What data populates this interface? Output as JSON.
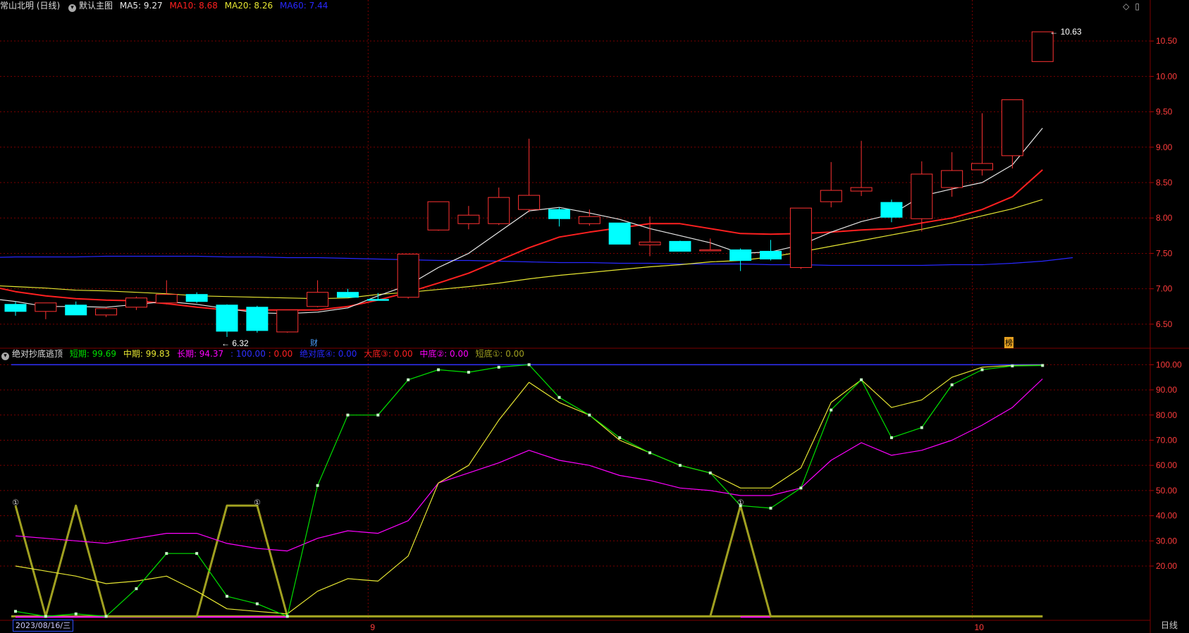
{
  "main_header": {
    "title": "常山北明 (日线)",
    "template": "默认主图",
    "ma5_label": "MA5: 9.27",
    "ma10_label": "MA10: 8.68",
    "ma20_label": "MA20: 8.26",
    "ma60_label": "MA60: 7.44"
  },
  "indicator_header": {
    "title": "绝对抄底逃顶",
    "short_label": "短期: 99.69",
    "mid_label": "中期: 99.83",
    "long_label": "长期: 94.37",
    "level_label": ": 100.00",
    "zero_label": ": 0.00",
    "abs_bottom_label": "绝对底④: 0.00",
    "big_bottom_label": "大底③: 0.00",
    "mid_bottom_label": "中底②: 0.00",
    "short_bottom_label": "短底①: 0.00"
  },
  "markers": {
    "cai": "财",
    "bang": "榜"
  },
  "footer": {
    "date": "2023/08/16/三",
    "period": "日线"
  },
  "colors": {
    "up": "#ff3232",
    "down": "#00ffff",
    "ma5": "#e8e8e8",
    "ma10": "#ff2020",
    "ma20": "#e6e632",
    "ma60": "#2828ff",
    "grid": "#7a0000",
    "short": "#00e000",
    "mid": "#e6e632",
    "long": "#ff00ff",
    "signal": "#a0a020",
    "level": "#3030ff"
  },
  "chart_data": [
    {
      "type": "candlestick",
      "title": "常山北明 (日线)",
      "y_ticks": [
        "6.50",
        "7.00",
        "7.50",
        "8.00",
        "8.50",
        "9.00",
        "9.50",
        "10.00",
        "10.50"
      ],
      "ylim": [
        6.2,
        10.9
      ],
      "x_ticks": [
        {
          "index": 12,
          "label": "9"
        },
        {
          "index": 32,
          "label": "10"
        }
      ],
      "candles": [
        {
          "o": 6.78,
          "h": 6.82,
          "l": 6.62,
          "c": 6.68
        },
        {
          "o": 6.68,
          "h": 6.8,
          "l": 6.57,
          "c": 6.8
        },
        {
          "o": 6.77,
          "h": 6.82,
          "l": 6.63,
          "c": 6.63
        },
        {
          "o": 6.63,
          "h": 6.74,
          "l": 6.6,
          "c": 6.72
        },
        {
          "o": 6.74,
          "h": 6.89,
          "l": 6.7,
          "c": 6.87
        },
        {
          "o": 6.8,
          "h": 7.12,
          "l": 6.78,
          "c": 6.92
        },
        {
          "o": 6.92,
          "h": 6.95,
          "l": 6.8,
          "c": 6.82
        },
        {
          "o": 6.77,
          "h": 6.78,
          "l": 6.32,
          "c": 6.4
        },
        {
          "o": 6.74,
          "h": 6.76,
          "l": 6.38,
          "c": 6.41
        },
        {
          "o": 6.39,
          "h": 6.7,
          "l": 6.38,
          "c": 6.7
        },
        {
          "o": 6.75,
          "h": 7.12,
          "l": 6.74,
          "c": 6.95
        },
        {
          "o": 6.95,
          "h": 7.0,
          "l": 6.88,
          "c": 6.88
        },
        {
          "o": 6.85,
          "h": 6.94,
          "l": 6.84,
          "c": 6.84
        },
        {
          "o": 6.88,
          "h": 7.49,
          "l": 6.86,
          "c": 7.49
        },
        {
          "o": 7.83,
          "h": 8.23,
          "l": 7.82,
          "c": 8.23
        },
        {
          "o": 7.92,
          "h": 8.17,
          "l": 7.84,
          "c": 8.04
        },
        {
          "o": 7.92,
          "h": 8.43,
          "l": 7.9,
          "c": 8.29
        },
        {
          "o": 8.12,
          "h": 9.12,
          "l": 8.08,
          "c": 8.32
        },
        {
          "o": 8.12,
          "h": 8.15,
          "l": 7.88,
          "c": 7.99
        },
        {
          "o": 7.92,
          "h": 8.12,
          "l": 7.89,
          "c": 8.02
        },
        {
          "o": 7.93,
          "h": 7.93,
          "l": 7.63,
          "c": 7.63
        },
        {
          "o": 7.62,
          "h": 8.02,
          "l": 7.46,
          "c": 7.66
        },
        {
          "o": 7.67,
          "h": 7.68,
          "l": 7.53,
          "c": 7.53
        },
        {
          "o": 7.54,
          "h": 7.71,
          "l": 7.53,
          "c": 7.55
        },
        {
          "o": 7.55,
          "h": 7.57,
          "l": 7.25,
          "c": 7.4
        },
        {
          "o": 7.53,
          "h": 7.69,
          "l": 7.4,
          "c": 7.42
        },
        {
          "o": 7.3,
          "h": 8.14,
          "l": 7.28,
          "c": 8.14
        },
        {
          "o": 8.23,
          "h": 8.79,
          "l": 8.15,
          "c": 8.39
        },
        {
          "o": 8.38,
          "h": 9.09,
          "l": 8.31,
          "c": 8.43
        },
        {
          "o": 8.22,
          "h": 8.26,
          "l": 7.94,
          "c": 8.01
        },
        {
          "o": 7.99,
          "h": 8.8,
          "l": 7.81,
          "c": 8.62
        },
        {
          "o": 8.43,
          "h": 8.93,
          "l": 8.3,
          "c": 8.67
        },
        {
          "o": 8.68,
          "h": 9.48,
          "l": 8.6,
          "c": 8.77
        },
        {
          "o": 8.88,
          "h": 9.67,
          "l": 8.7,
          "c": 9.67
        },
        {
          "o": 10.21,
          "h": 10.63,
          "l": 10.21,
          "c": 10.63
        }
      ],
      "ma5": [
        6.87,
        6.82,
        6.75,
        6.75,
        6.74,
        6.78,
        6.82,
        6.78,
        6.72,
        6.66,
        6.65,
        6.67,
        6.73,
        6.9,
        7.05,
        7.3,
        7.5,
        7.8,
        8.1,
        8.15,
        8.07,
        7.98,
        7.85,
        7.75,
        7.65,
        7.5,
        7.52,
        7.62,
        7.8,
        7.95,
        8.05,
        8.31,
        8.41,
        8.5,
        8.75,
        9.27
      ],
      "ma10": [
        7.05,
        6.96,
        6.9,
        6.86,
        6.84,
        6.83,
        6.79,
        6.74,
        6.7,
        6.7,
        6.7,
        6.7,
        6.75,
        6.84,
        6.95,
        7.08,
        7.22,
        7.4,
        7.58,
        7.73,
        7.8,
        7.86,
        7.92,
        7.92,
        7.85,
        7.78,
        7.77,
        7.78,
        7.8,
        7.83,
        7.85,
        7.93,
        8.0,
        8.12,
        8.3,
        8.68
      ],
      "ma20": [
        7.05,
        7.03,
        7.01,
        6.98,
        6.97,
        6.95,
        6.93,
        6.9,
        6.89,
        6.88,
        6.87,
        6.86,
        6.87,
        6.92,
        6.95,
        6.99,
        7.03,
        7.08,
        7.14,
        7.19,
        7.23,
        7.27,
        7.31,
        7.34,
        7.38,
        7.4,
        7.45,
        7.52,
        7.6,
        7.68,
        7.76,
        7.84,
        7.93,
        8.03,
        8.13,
        8.26
      ],
      "ma60": [
        7.44,
        7.45,
        7.45,
        7.45,
        7.46,
        7.46,
        7.46,
        7.46,
        7.45,
        7.45,
        7.44,
        7.44,
        7.43,
        7.42,
        7.41,
        7.4,
        7.4,
        7.39,
        7.38,
        7.37,
        7.37,
        7.36,
        7.36,
        7.35,
        7.35,
        7.35,
        7.34,
        7.34,
        7.33,
        7.33,
        7.33,
        7.33,
        7.34,
        7.34,
        7.36,
        7.39,
        7.44
      ],
      "annotations": [
        {
          "index": 7,
          "value": 6.32,
          "text": "6.32"
        },
        {
          "index": 34,
          "value": 10.63,
          "text": "10.63"
        }
      ]
    },
    {
      "type": "line",
      "title": "绝对抄底逃顶",
      "y_ticks": [
        "20.00",
        "30.00",
        "40.00",
        "50.00",
        "60.00",
        "70.00",
        "80.00",
        "90.00",
        "100.00"
      ],
      "ylim": [
        -1,
        101.5
      ],
      "series": [
        {
          "name": "短期",
          "values": [
            2,
            0,
            1,
            0,
            11,
            25,
            25,
            8,
            5,
            0,
            52,
            80,
            80,
            94,
            98,
            97,
            99,
            100,
            87,
            80,
            71,
            65,
            60,
            57,
            44,
            43,
            51,
            82,
            94,
            71,
            75,
            92,
            98,
            99.5,
            99.69
          ]
        },
        {
          "name": "中期",
          "values": [
            20,
            18,
            16,
            13,
            14,
            16,
            10,
            3,
            2,
            1,
            10,
            15,
            14,
            24,
            53,
            60,
            78,
            93,
            85,
            80,
            70,
            65,
            60,
            57,
            51,
            51,
            59,
            85,
            94,
            83,
            86,
            95,
            99,
            99.7,
            99.83
          ]
        },
        {
          "name": "长期",
          "values": [
            32,
            31,
            30,
            29,
            31,
            33,
            33,
            29,
            27,
            26,
            31,
            34,
            33,
            38,
            53,
            57,
            61,
            66,
            62,
            60,
            56,
            54,
            51,
            50,
            48,
            48,
            51,
            62,
            69,
            64,
            66,
            70,
            76,
            83,
            94.37
          ]
        },
        {
          "name": "短底①",
          "values": [
            44,
            0,
            44,
            0,
            0,
            0,
            0,
            44,
            44,
            0,
            0,
            0,
            0,
            0,
            0,
            0,
            0,
            0,
            0,
            0,
            0,
            0,
            0,
            0,
            44,
            0,
            0,
            0,
            0,
            0,
            0,
            0,
            0,
            0,
            0
          ]
        }
      ],
      "level_line": 100,
      "signal_marks": [
        {
          "index": 0,
          "text": "①"
        },
        {
          "index": 8,
          "text": "①"
        },
        {
          "index": 24,
          "text": "①"
        }
      ]
    }
  ]
}
